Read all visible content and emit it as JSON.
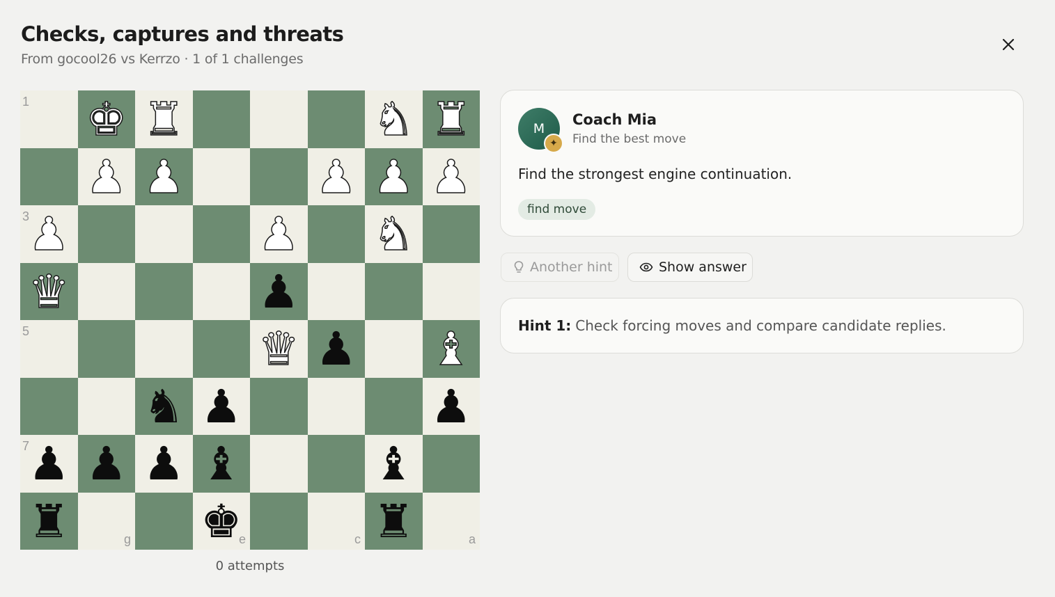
{
  "header": {
    "title": "Checks, captures and threats",
    "subtitle": "From gocool26 vs Kerrzo · 1 of 1 challenges"
  },
  "board": {
    "colors": {
      "light": "#f0efe6",
      "dark": "#6d8c72"
    },
    "rows": [
      [
        "",
        "wK",
        "wR",
        "",
        "",
        "",
        "wN",
        "wR"
      ],
      [
        "",
        "wP",
        "wP",
        "",
        "",
        "wP",
        "wP",
        "wP"
      ],
      [
        "wP",
        "",
        "",
        "",
        "wP",
        "",
        "wN",
        ""
      ],
      [
        "wQ",
        "",
        "",
        "",
        "bP",
        "",
        "",
        ""
      ],
      [
        "",
        "",
        "",
        "",
        "wQ",
        "bP",
        "",
        "wB"
      ],
      [
        "",
        "",
        "bN",
        "bP",
        "",
        "",
        "",
        "bP"
      ],
      [
        "bP",
        "bP",
        "bP",
        "bB",
        "",
        "",
        "bB",
        ""
      ],
      [
        "bR",
        "",
        "",
        "bK",
        "",
        "",
        "bR",
        ""
      ]
    ],
    "rank_labels": [
      "1",
      "",
      "3",
      "",
      "5",
      "",
      "7",
      ""
    ],
    "file_labels": [
      "",
      "g",
      "",
      "e",
      "",
      "c",
      "",
      "a"
    ],
    "attempts": "0 attempts"
  },
  "coach": {
    "avatar_initial": "M",
    "name": "Coach Mia",
    "role": "Find the best move",
    "message": "Find the strongest engine continuation.",
    "tag": "find move"
  },
  "actions": {
    "hint_label": "Another hint",
    "answer_label": "Show answer"
  },
  "hint": {
    "label": "Hint 1:",
    "text": "Check forcing moves and compare candidate replies."
  }
}
